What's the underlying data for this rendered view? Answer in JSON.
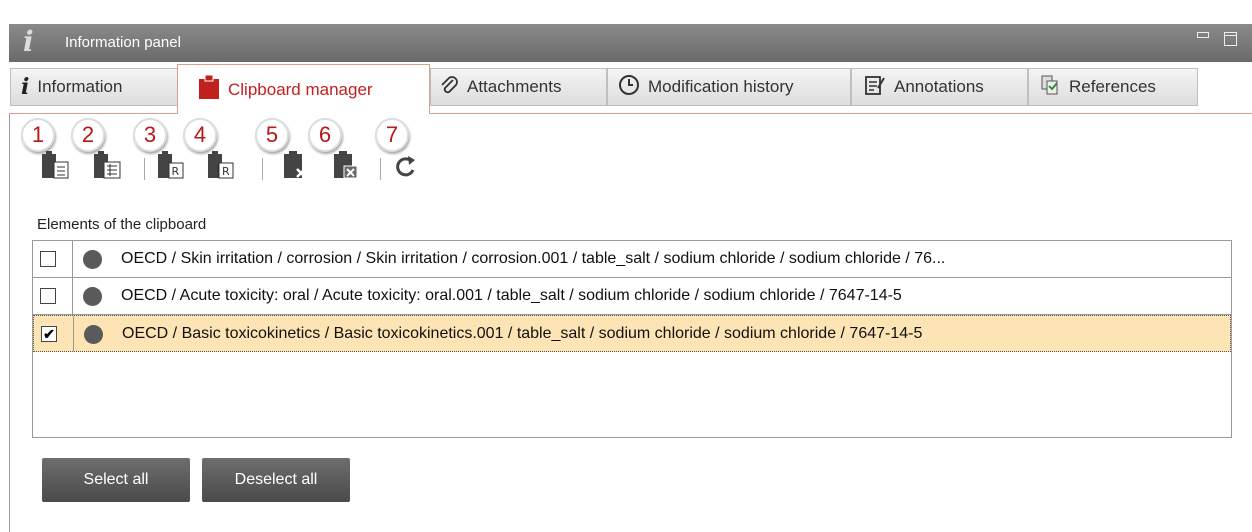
{
  "panel": {
    "title": "Information panel"
  },
  "tabs": [
    {
      "label": "Information",
      "icon": "info-icon"
    },
    {
      "label": "Clipboard manager",
      "icon": "clipboard-icon",
      "active": true
    },
    {
      "label": "Attachments",
      "icon": "paperclip-icon"
    },
    {
      "label": "Modification history",
      "icon": "clock-icon"
    },
    {
      "label": "Annotations",
      "icon": "annotation-icon"
    },
    {
      "label": "References",
      "icon": "references-icon"
    }
  ],
  "toolbar": {
    "badges": [
      "1",
      "2",
      "3",
      "4",
      "5",
      "6",
      "7"
    ]
  },
  "clipboard": {
    "section_label": "Elements of the clipboard",
    "items": [
      {
        "text": "OECD / Skin irritation / corrosion / Skin irritation / corrosion.001 / table_salt / sodium chloride / sodium chloride / 76...",
        "checked": false,
        "selected": false
      },
      {
        "text": "OECD / Acute toxicity: oral / Acute toxicity: oral.001 / table_salt / sodium chloride / sodium chloride / 7647-14-5",
        "checked": false,
        "selected": false
      },
      {
        "text": "OECD / Basic toxicokinetics / Basic toxicokinetics.001 / table_salt / sodium chloride / sodium chloride / 7647-14-5",
        "checked": true,
        "selected": true
      }
    ]
  },
  "buttons": {
    "select_all": "Select all",
    "deselect_all": "Deselect all"
  },
  "colors": {
    "accent": "#c21f1f",
    "selected_row": "#fde4b5",
    "titlebar": "#7a7a7a"
  }
}
